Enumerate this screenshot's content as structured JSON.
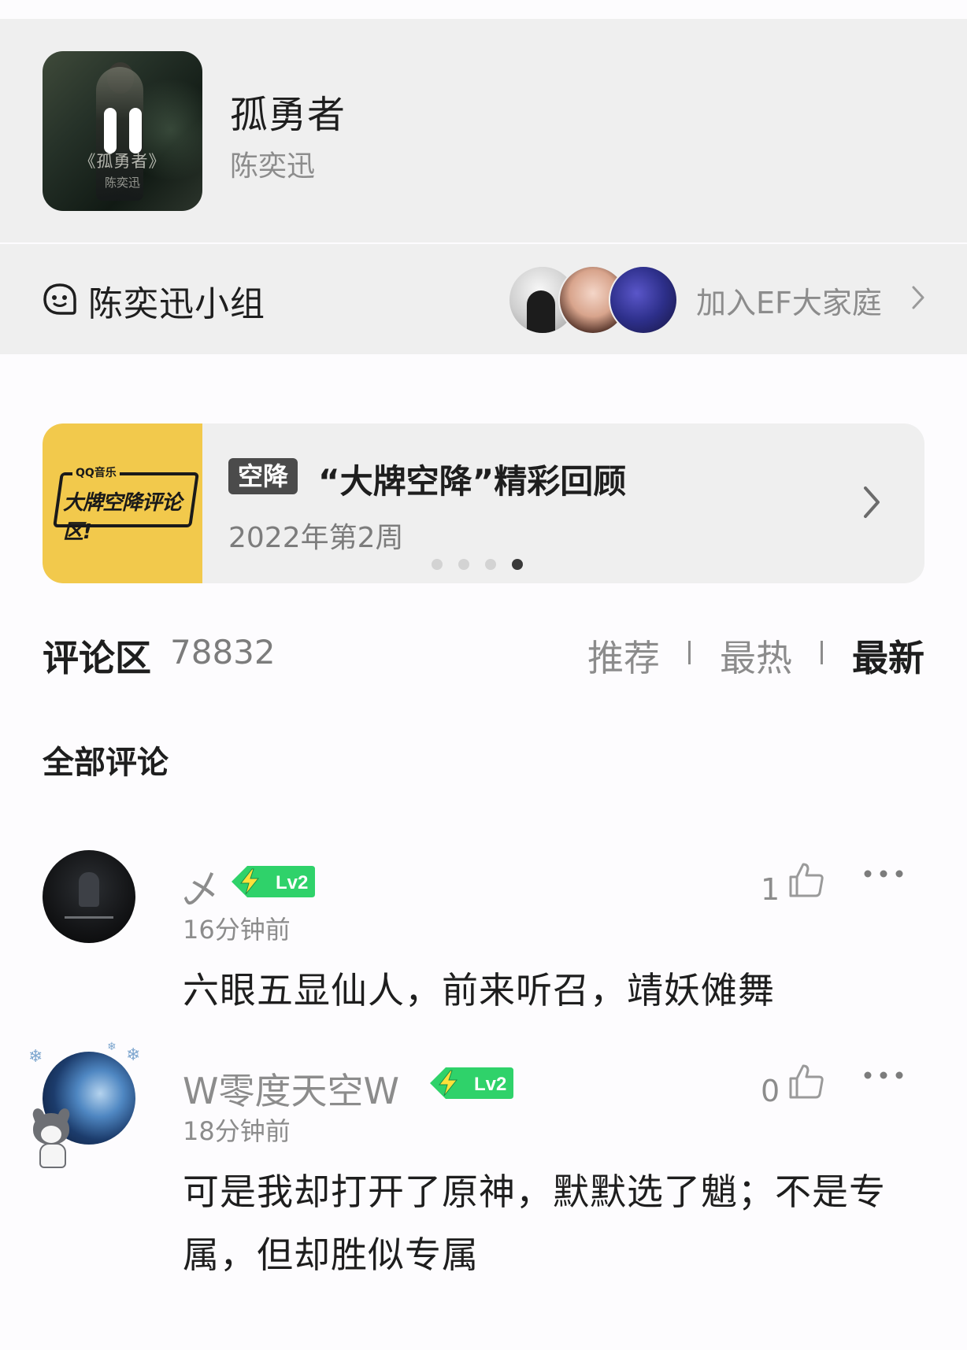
{
  "song": {
    "title": "孤勇者",
    "artist": "陈奕迅",
    "art_title": "《孤勇者》",
    "art_artist": "陈奕迅",
    "player_state": "playing"
  },
  "group": {
    "name": "陈奕迅小组",
    "join_label": "加入EF大家庭"
  },
  "banner": {
    "tag": "空降",
    "title": "“大牌空降”精彩回顾",
    "subtitle": "2022年第2周",
    "image_logo": "QQ音乐",
    "image_slogan": "大牌空降评论区!",
    "active_dot": 4,
    "dot_count": 4
  },
  "comments_header": {
    "title": "评论区",
    "count": "78832",
    "sort_tabs": [
      "推荐",
      "最热",
      "最新"
    ],
    "active_sort": "最新",
    "section_title": "全部评论"
  },
  "comments": [
    {
      "username": "乄",
      "level": "Lv2",
      "time": "16分钟前",
      "text": "六眼五显仙人，前来听召，靖妖傩舞",
      "likes": "1"
    },
    {
      "username": "W零度天空W",
      "level": "Lv2",
      "time": "18分钟前",
      "text": "可是我却打开了原神，默默选了魈；不是专属，但却胜似专属",
      "likes": "0"
    }
  ],
  "colors": {
    "background": "#fdfcfe",
    "panel": "#efefef",
    "banner_image": "#f2c94c",
    "level_badge": "#2fd26a",
    "muted_text": "#8c8c8c"
  },
  "icons": {
    "group": "chat-face-icon",
    "chevron": "chevron-right-icon",
    "like": "thumbs-up-icon",
    "more": "more-dots-icon",
    "level": "lightning-icon"
  }
}
